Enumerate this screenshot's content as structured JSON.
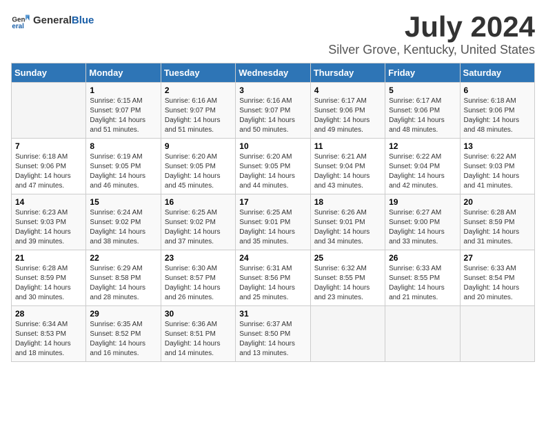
{
  "header": {
    "logo_general": "General",
    "logo_blue": "Blue",
    "title": "July 2024",
    "location": "Silver Grove, Kentucky, United States"
  },
  "calendar": {
    "days_of_week": [
      "Sunday",
      "Monday",
      "Tuesday",
      "Wednesday",
      "Thursday",
      "Friday",
      "Saturday"
    ],
    "weeks": [
      [
        {
          "day": "",
          "info": ""
        },
        {
          "day": "1",
          "info": "Sunrise: 6:15 AM\nSunset: 9:07 PM\nDaylight: 14 hours\nand 51 minutes."
        },
        {
          "day": "2",
          "info": "Sunrise: 6:16 AM\nSunset: 9:07 PM\nDaylight: 14 hours\nand 51 minutes."
        },
        {
          "day": "3",
          "info": "Sunrise: 6:16 AM\nSunset: 9:07 PM\nDaylight: 14 hours\nand 50 minutes."
        },
        {
          "day": "4",
          "info": "Sunrise: 6:17 AM\nSunset: 9:06 PM\nDaylight: 14 hours\nand 49 minutes."
        },
        {
          "day": "5",
          "info": "Sunrise: 6:17 AM\nSunset: 9:06 PM\nDaylight: 14 hours\nand 48 minutes."
        },
        {
          "day": "6",
          "info": "Sunrise: 6:18 AM\nSunset: 9:06 PM\nDaylight: 14 hours\nand 48 minutes."
        }
      ],
      [
        {
          "day": "7",
          "info": "Sunrise: 6:18 AM\nSunset: 9:06 PM\nDaylight: 14 hours\nand 47 minutes."
        },
        {
          "day": "8",
          "info": "Sunrise: 6:19 AM\nSunset: 9:05 PM\nDaylight: 14 hours\nand 46 minutes."
        },
        {
          "day": "9",
          "info": "Sunrise: 6:20 AM\nSunset: 9:05 PM\nDaylight: 14 hours\nand 45 minutes."
        },
        {
          "day": "10",
          "info": "Sunrise: 6:20 AM\nSunset: 9:05 PM\nDaylight: 14 hours\nand 44 minutes."
        },
        {
          "day": "11",
          "info": "Sunrise: 6:21 AM\nSunset: 9:04 PM\nDaylight: 14 hours\nand 43 minutes."
        },
        {
          "day": "12",
          "info": "Sunrise: 6:22 AM\nSunset: 9:04 PM\nDaylight: 14 hours\nand 42 minutes."
        },
        {
          "day": "13",
          "info": "Sunrise: 6:22 AM\nSunset: 9:03 PM\nDaylight: 14 hours\nand 41 minutes."
        }
      ],
      [
        {
          "day": "14",
          "info": "Sunrise: 6:23 AM\nSunset: 9:03 PM\nDaylight: 14 hours\nand 39 minutes."
        },
        {
          "day": "15",
          "info": "Sunrise: 6:24 AM\nSunset: 9:02 PM\nDaylight: 14 hours\nand 38 minutes."
        },
        {
          "day": "16",
          "info": "Sunrise: 6:25 AM\nSunset: 9:02 PM\nDaylight: 14 hours\nand 37 minutes."
        },
        {
          "day": "17",
          "info": "Sunrise: 6:25 AM\nSunset: 9:01 PM\nDaylight: 14 hours\nand 35 minutes."
        },
        {
          "day": "18",
          "info": "Sunrise: 6:26 AM\nSunset: 9:01 PM\nDaylight: 14 hours\nand 34 minutes."
        },
        {
          "day": "19",
          "info": "Sunrise: 6:27 AM\nSunset: 9:00 PM\nDaylight: 14 hours\nand 33 minutes."
        },
        {
          "day": "20",
          "info": "Sunrise: 6:28 AM\nSunset: 8:59 PM\nDaylight: 14 hours\nand 31 minutes."
        }
      ],
      [
        {
          "day": "21",
          "info": "Sunrise: 6:28 AM\nSunset: 8:59 PM\nDaylight: 14 hours\nand 30 minutes."
        },
        {
          "day": "22",
          "info": "Sunrise: 6:29 AM\nSunset: 8:58 PM\nDaylight: 14 hours\nand 28 minutes."
        },
        {
          "day": "23",
          "info": "Sunrise: 6:30 AM\nSunset: 8:57 PM\nDaylight: 14 hours\nand 26 minutes."
        },
        {
          "day": "24",
          "info": "Sunrise: 6:31 AM\nSunset: 8:56 PM\nDaylight: 14 hours\nand 25 minutes."
        },
        {
          "day": "25",
          "info": "Sunrise: 6:32 AM\nSunset: 8:55 PM\nDaylight: 14 hours\nand 23 minutes."
        },
        {
          "day": "26",
          "info": "Sunrise: 6:33 AM\nSunset: 8:55 PM\nDaylight: 14 hours\nand 21 minutes."
        },
        {
          "day": "27",
          "info": "Sunrise: 6:33 AM\nSunset: 8:54 PM\nDaylight: 14 hours\nand 20 minutes."
        }
      ],
      [
        {
          "day": "28",
          "info": "Sunrise: 6:34 AM\nSunset: 8:53 PM\nDaylight: 14 hours\nand 18 minutes."
        },
        {
          "day": "29",
          "info": "Sunrise: 6:35 AM\nSunset: 8:52 PM\nDaylight: 14 hours\nand 16 minutes."
        },
        {
          "day": "30",
          "info": "Sunrise: 6:36 AM\nSunset: 8:51 PM\nDaylight: 14 hours\nand 14 minutes."
        },
        {
          "day": "31",
          "info": "Sunrise: 6:37 AM\nSunset: 8:50 PM\nDaylight: 14 hours\nand 13 minutes."
        },
        {
          "day": "",
          "info": ""
        },
        {
          "day": "",
          "info": ""
        },
        {
          "day": "",
          "info": ""
        }
      ]
    ]
  }
}
